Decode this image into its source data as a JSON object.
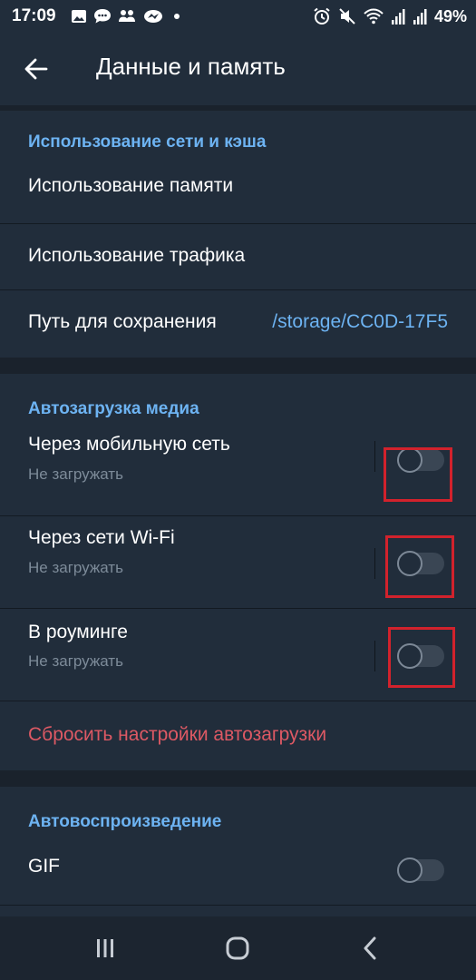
{
  "status_bar": {
    "time": "17:09",
    "battery": "49%",
    "left_icons": [
      "gallery-icon",
      "chat-bubble-icon",
      "people-icon",
      "messenger-icon",
      "dot-icon"
    ],
    "right_icons": [
      "alarm-icon",
      "mute-icon",
      "wifi-icon",
      "signal-icon",
      "signal-icon"
    ]
  },
  "appbar": {
    "title": "Данные и память"
  },
  "network_section": {
    "header": "Использование сети и кэша",
    "items": [
      {
        "label": "Использование памяти"
      },
      {
        "label": "Использование трафика"
      },
      {
        "label": "Путь для сохранения",
        "value": "/storage/CC0D-17F5"
      }
    ]
  },
  "autodownload_section": {
    "header": "Автозагрузка медиа",
    "items": [
      {
        "label": "Через мобильную сеть",
        "sub": "Не загружать",
        "enabled": false
      },
      {
        "label": "Через сети Wi-Fi",
        "sub": "Не загружать",
        "enabled": false
      },
      {
        "label": "В роуминге",
        "sub": "Не загружать",
        "enabled": false
      }
    ],
    "reset_label": "Сбросить настройки автозагрузки"
  },
  "autoplay_section": {
    "header": "Автовоспроизведение",
    "items": [
      {
        "label": "GIF",
        "enabled": false
      }
    ]
  },
  "colors": {
    "accent": "#6db3f2",
    "danger": "#dd5964",
    "highlight": "#d2222c",
    "background": "#212d3b"
  }
}
